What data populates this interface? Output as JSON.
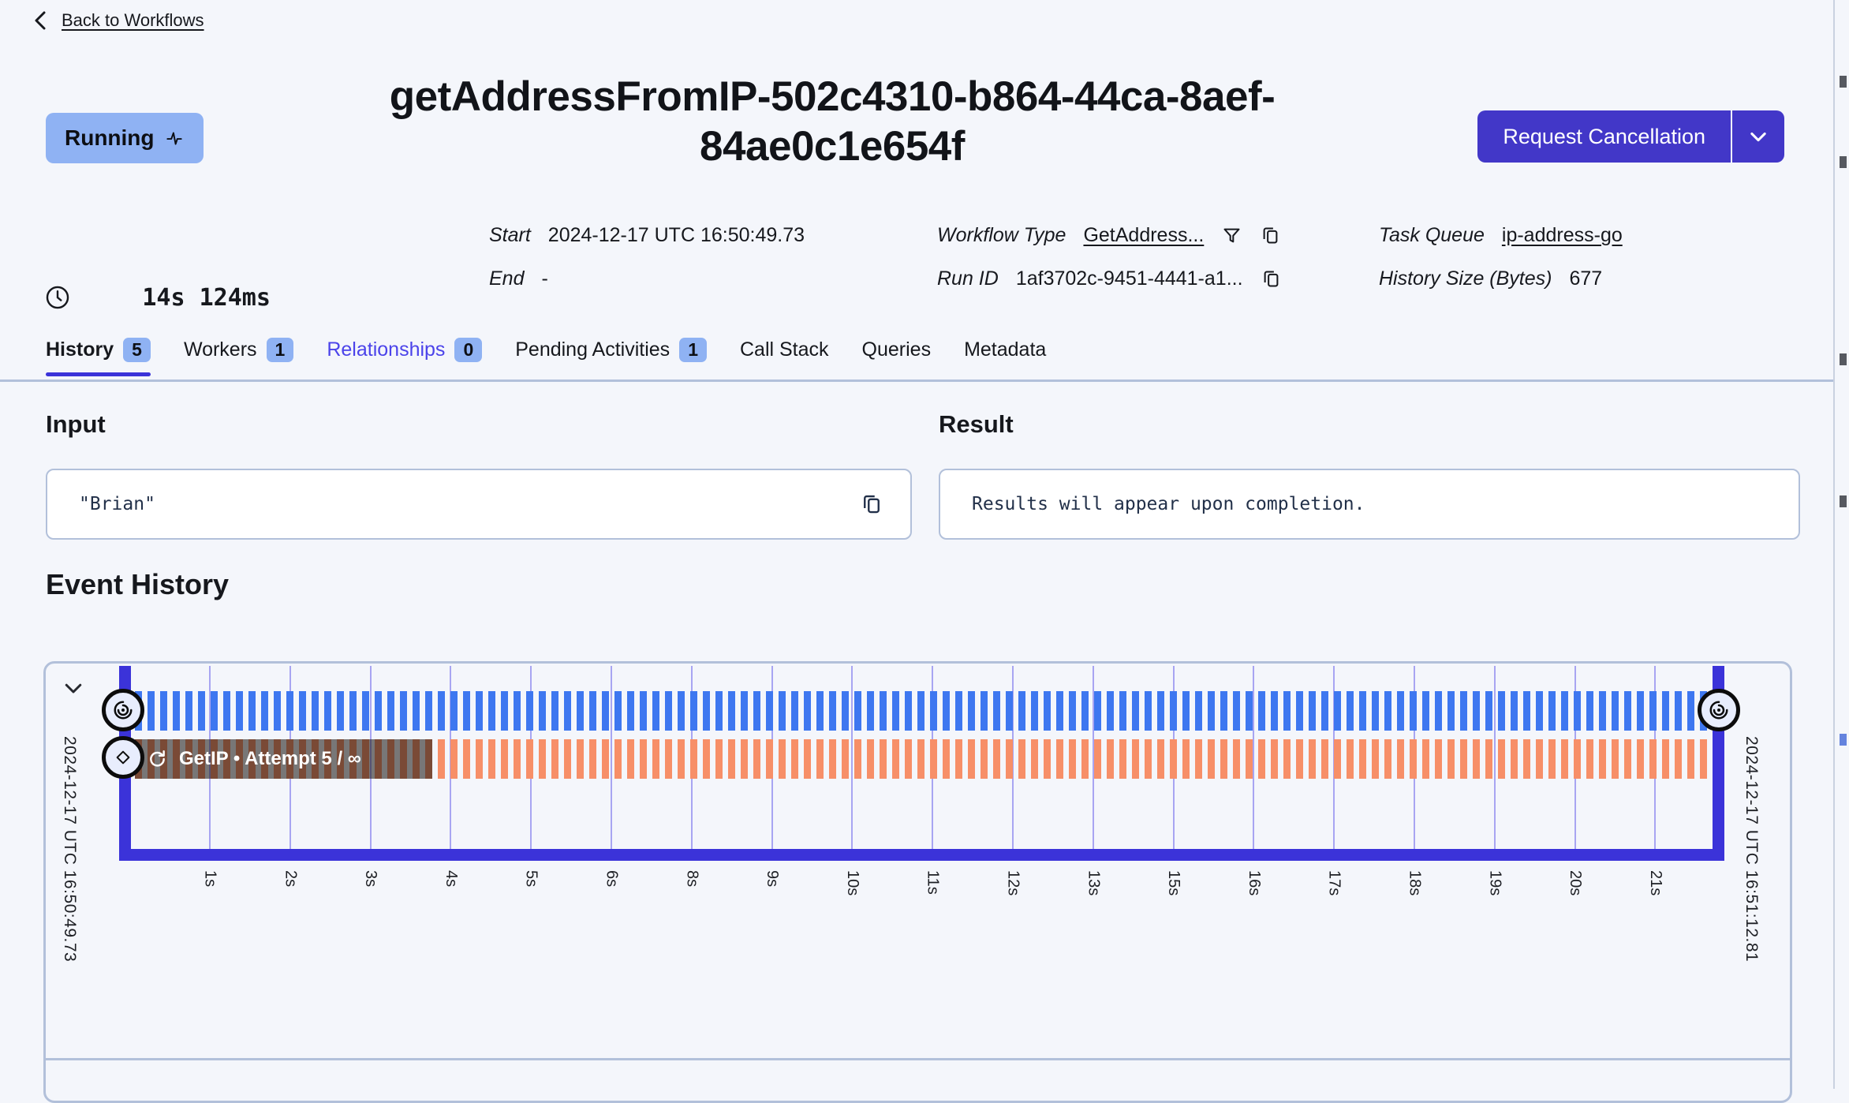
{
  "header": {
    "back_label": "Back to Workflows"
  },
  "workflow": {
    "status": "Running",
    "title_line1": "getAddressFromIP-502c4310-b864-44ca-8aef-",
    "title_line2": "84ae0c1e654f",
    "cancel_label": "Request Cancellation",
    "duration": "14s 124ms",
    "meta": {
      "start_label": "Start",
      "start_value": "2024-12-17 UTC 16:50:49.73",
      "end_label": "End",
      "end_value": "-",
      "type_label": "Workflow Type",
      "type_value": "GetAddress...",
      "run_id_label": "Run ID",
      "run_id_value": "1af3702c-9451-4441-a1...",
      "task_queue_label": "Task Queue",
      "task_queue_value": "ip-address-go",
      "history_size_label": "History Size (Bytes)",
      "history_size_value": "677"
    }
  },
  "tabs": [
    {
      "label": "History",
      "count": "5",
      "active": true
    },
    {
      "label": "Workers",
      "count": "1"
    },
    {
      "label": "Relationships",
      "count": "0",
      "highlight": true
    },
    {
      "label": "Pending Activities",
      "count": "1"
    },
    {
      "label": "Call Stack"
    },
    {
      "label": "Queries"
    },
    {
      "label": "Metadata"
    }
  ],
  "io": {
    "input_label": "Input",
    "input_value": "\"Brian\"",
    "result_label": "Result",
    "result_value": "Results will appear upon completion."
  },
  "event_history": {
    "title": "Event History",
    "start_time": "2024-12-17 UTC 16:50:49.73",
    "end_time": "2024-12-17 UTC 16:51:12.81",
    "activity_label": "GetIP • Attempt 5 / ∞",
    "ticks": [
      "1s",
      "2s",
      "3s",
      "4s",
      "5s",
      "6s",
      "8s",
      "9s",
      "10s",
      "11s",
      "12s",
      "13s",
      "15s",
      "16s",
      "17s",
      "18s",
      "19s",
      "20s",
      "21s"
    ]
  },
  "colors": {
    "accent_indigo": "#3b33d9",
    "stripe_blue": "#3e77f0",
    "stripe_orange": "#f78f68",
    "badge_blue": "#8fb2f3",
    "button_indigo": "#4237c8",
    "divider": "#b2c0da"
  }
}
